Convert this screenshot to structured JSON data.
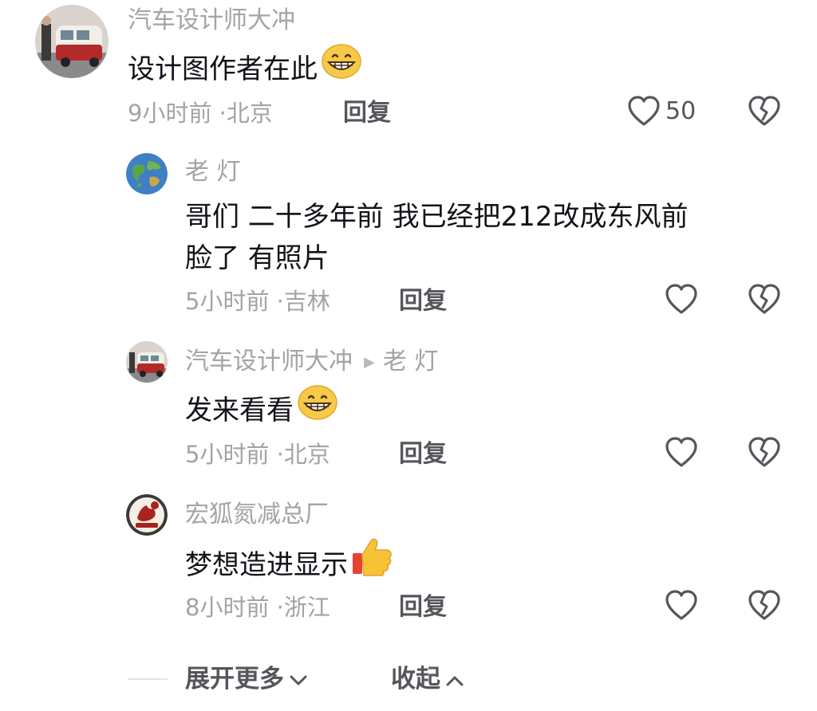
{
  "comments": [
    {
      "author": "汽车设计师大冲",
      "text": "设计图作者在此",
      "emoji": "grin-emoji",
      "time": "9小时前",
      "location": "北京",
      "reply_label": "回复",
      "like_count": "50"
    },
    {
      "author": "老 灯",
      "text_line1": "哥们 二十多年前 我已经把212改成东风前",
      "text_line2": "脸了 有照片",
      "time": "5小时前",
      "location": "吉林",
      "reply_label": "回复"
    },
    {
      "author": "汽车设计师大冲",
      "reply_to": "老 灯",
      "text": "发来看看",
      "emoji": "grin-emoji",
      "time": "5小时前",
      "location": "北京",
      "reply_label": "回复"
    },
    {
      "author": "宏狐氮减总厂",
      "text": "梦想造进显示",
      "emoji": "thumbs-up-emoji",
      "time": "8小时前",
      "location": "浙江",
      "reply_label": "回复"
    }
  ],
  "footer": {
    "expand_label": "展开更多",
    "collapse_label": "收起"
  },
  "colors": {
    "secondary_text": "#a3a3a8",
    "primary_text": "#111318",
    "action_text": "#55565c"
  },
  "separator": "·"
}
